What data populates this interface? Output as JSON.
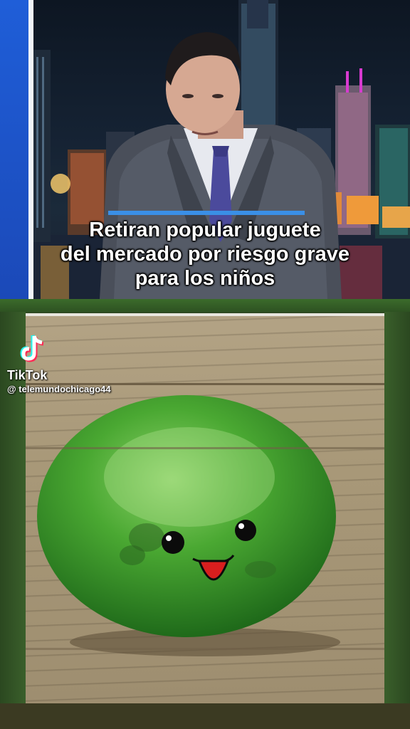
{
  "news": {
    "headline_lines": [
      "Retiran popular juguete",
      "del mercado por riesgo grave",
      "para los niños"
    ]
  },
  "watermark": {
    "icon": "tiktok-logo-icon",
    "brand": "TikTok",
    "handle": "@ telemundochicago44"
  },
  "photo": {
    "subject": "green-squishy-toy-icon"
  },
  "colors": {
    "accent_blue": "#1f5ed8",
    "bar_blue": "#3a8fe6",
    "toy_green": "#3fa12f",
    "frame_green": "#2f4a22"
  }
}
